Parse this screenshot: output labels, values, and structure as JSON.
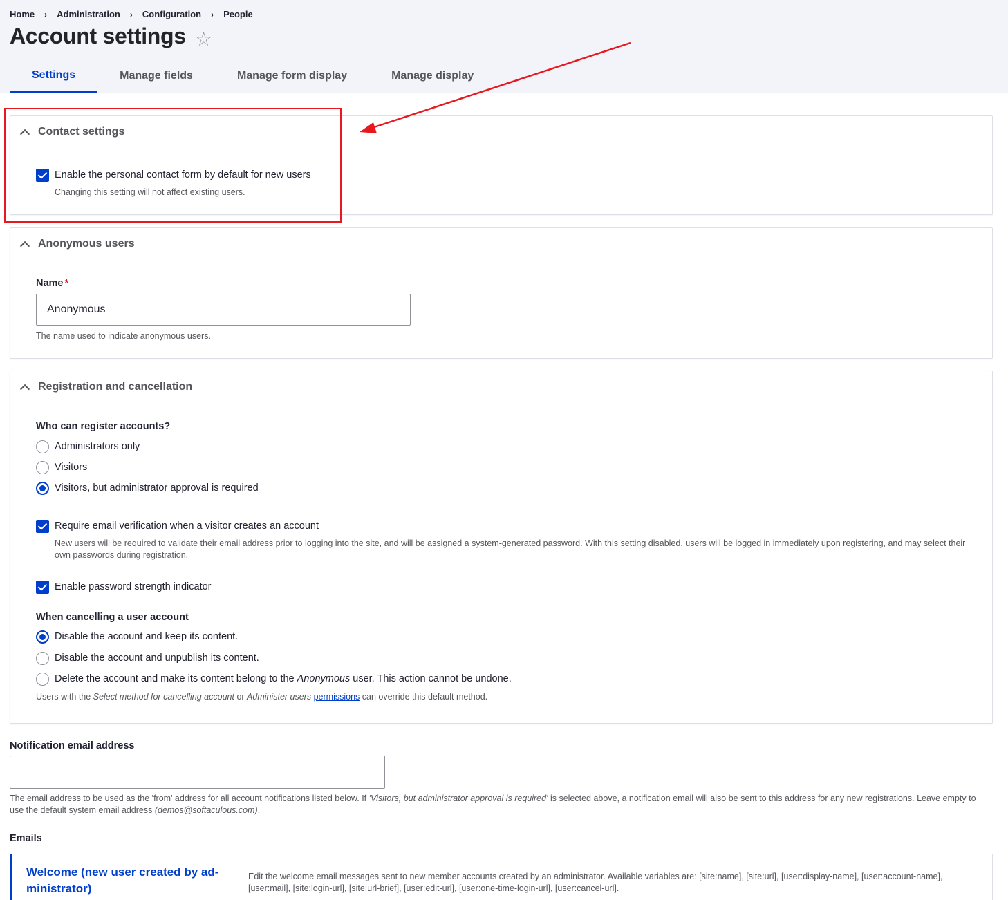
{
  "breadcrumb": {
    "items": [
      "Home",
      "Administration",
      "Configuration",
      "People"
    ],
    "separator": "›"
  },
  "page": {
    "title": "Account settings",
    "favorite_icon": "star-outline-icon"
  },
  "tabs": [
    {
      "label": "Settings",
      "active": true
    },
    {
      "label": "Manage fields",
      "active": false
    },
    {
      "label": "Manage form display",
      "active": false
    },
    {
      "label": "Manage display",
      "active": false
    }
  ],
  "contact": {
    "legend": "Contact settings",
    "checkbox_label": "Enable the personal contact form by default for new users",
    "checkbox_checked": true,
    "description": "Changing this setting will not affect existing users."
  },
  "anonymous": {
    "legend": "Anonymous users",
    "name_label": "Name",
    "required_mark": "*",
    "name_value": "Anonymous",
    "description": "The name used to indicate anonymous users."
  },
  "registration": {
    "legend": "Registration and cancellation",
    "who_label": "Who can register accounts?",
    "who_options": [
      {
        "label": "Administrators only",
        "selected": false
      },
      {
        "label": "Visitors",
        "selected": false
      },
      {
        "label": "Visitors, but administrator approval is required",
        "selected": true
      }
    ],
    "email_verification_label": "Require email verification when a visitor creates an account",
    "email_verification_checked": true,
    "email_verification_desc": "New users will be required to validate their email address prior to logging into the site, and will be assigned a system-generated password. With this setting disabled, users will be logged in immediately upon registering, and may select their own passwords during registration.",
    "password_strength_label": "Enable password strength indicator",
    "password_strength_checked": true,
    "cancel_label": "When cancelling a user account",
    "cancel_options": [
      {
        "label": "Disable the account and keep its content.",
        "selected": true
      },
      {
        "label": "Disable the account and unpublish its content.",
        "selected": false
      },
      {
        "label_pre": "Delete the account and make its content belong to the ",
        "label_em": "Anonymous",
        "label_post": " user. This action cannot be undone.",
        "selected": false
      }
    ],
    "cancel_help": {
      "pre": "Users with the ",
      "em1": "Select method for cancelling account",
      "mid": " or ",
      "em2": "Administer users",
      "space": " ",
      "link": "permissions",
      "post": " can override this default method."
    }
  },
  "notification": {
    "label": "Notification email address",
    "value": "",
    "help_pre": "The email address to be used as the 'from' address for all account notifications listed below. If ",
    "help_em": "'Visitors, but administrator approval is required'",
    "help_mid": " is selected above, a notification email will also be sent to this address for any new registrations. Leave empty to use the default system email address ",
    "help_em2": "(demos@softaculous.com)",
    "help_post": "."
  },
  "emails": {
    "heading": "Emails",
    "first_item_title": "Welcome (new user created by ad-ministrator)",
    "first_item_desc": "Edit the welcome email messages sent to new member accounts created by an administrator. Available variables are: [site:name], [site:url], [user:display-name], [user:account-name], [user:mail], [site:login-url], [site:url-brief], [user:edit-url], [user:one-time-login-url], [user:cancel-url]."
  },
  "annotation": {
    "color": "#e8191e"
  },
  "colors": {
    "accent": "#003ecc",
    "header_bg": "#f3f4f9",
    "required": "#d72222"
  }
}
